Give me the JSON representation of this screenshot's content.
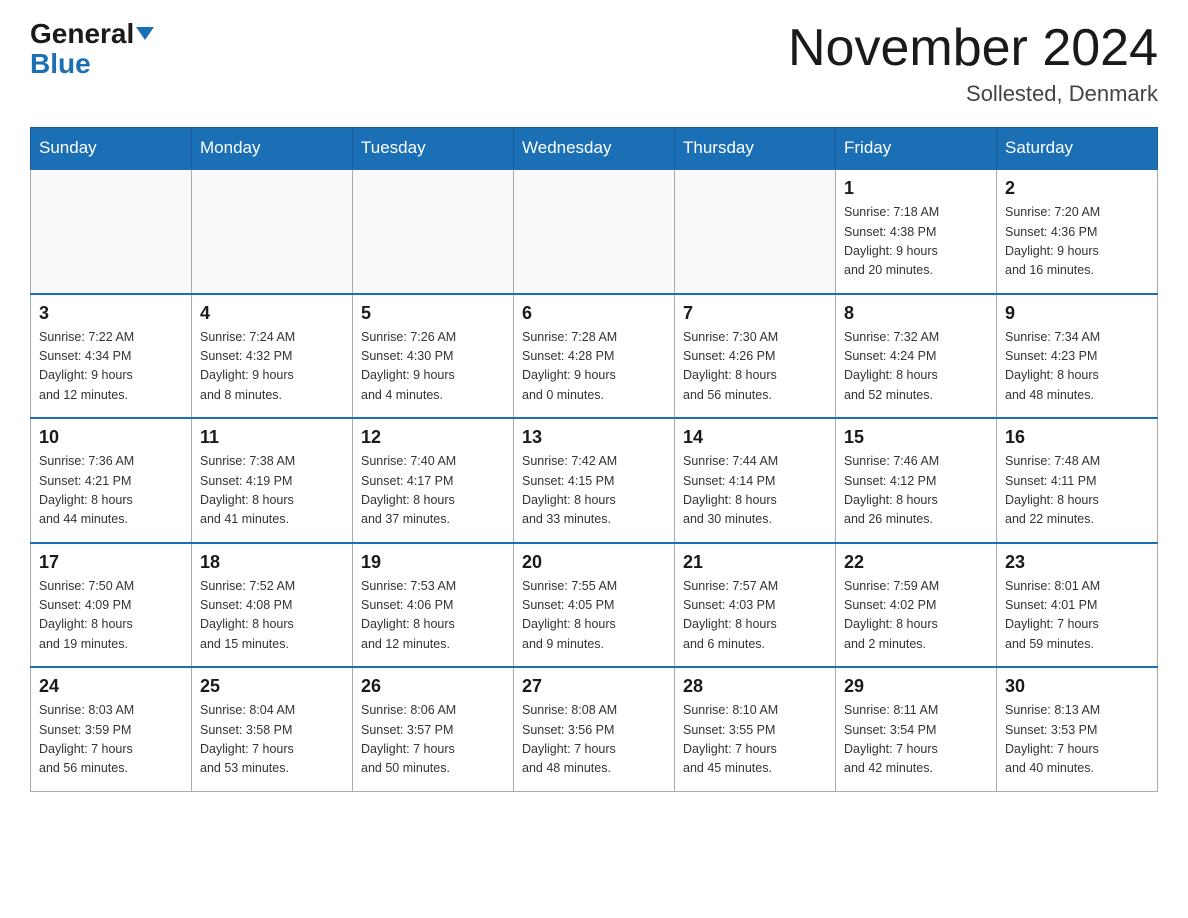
{
  "header": {
    "logo_general": "General",
    "logo_blue": "Blue",
    "month_title": "November 2024",
    "location": "Sollested, Denmark"
  },
  "days_of_week": [
    "Sunday",
    "Monday",
    "Tuesday",
    "Wednesday",
    "Thursday",
    "Friday",
    "Saturday"
  ],
  "weeks": [
    [
      {
        "day": "",
        "info": ""
      },
      {
        "day": "",
        "info": ""
      },
      {
        "day": "",
        "info": ""
      },
      {
        "day": "",
        "info": ""
      },
      {
        "day": "",
        "info": ""
      },
      {
        "day": "1",
        "info": "Sunrise: 7:18 AM\nSunset: 4:38 PM\nDaylight: 9 hours\nand 20 minutes."
      },
      {
        "day": "2",
        "info": "Sunrise: 7:20 AM\nSunset: 4:36 PM\nDaylight: 9 hours\nand 16 minutes."
      }
    ],
    [
      {
        "day": "3",
        "info": "Sunrise: 7:22 AM\nSunset: 4:34 PM\nDaylight: 9 hours\nand 12 minutes."
      },
      {
        "day": "4",
        "info": "Sunrise: 7:24 AM\nSunset: 4:32 PM\nDaylight: 9 hours\nand 8 minutes."
      },
      {
        "day": "5",
        "info": "Sunrise: 7:26 AM\nSunset: 4:30 PM\nDaylight: 9 hours\nand 4 minutes."
      },
      {
        "day": "6",
        "info": "Sunrise: 7:28 AM\nSunset: 4:28 PM\nDaylight: 9 hours\nand 0 minutes."
      },
      {
        "day": "7",
        "info": "Sunrise: 7:30 AM\nSunset: 4:26 PM\nDaylight: 8 hours\nand 56 minutes."
      },
      {
        "day": "8",
        "info": "Sunrise: 7:32 AM\nSunset: 4:24 PM\nDaylight: 8 hours\nand 52 minutes."
      },
      {
        "day": "9",
        "info": "Sunrise: 7:34 AM\nSunset: 4:23 PM\nDaylight: 8 hours\nand 48 minutes."
      }
    ],
    [
      {
        "day": "10",
        "info": "Sunrise: 7:36 AM\nSunset: 4:21 PM\nDaylight: 8 hours\nand 44 minutes."
      },
      {
        "day": "11",
        "info": "Sunrise: 7:38 AM\nSunset: 4:19 PM\nDaylight: 8 hours\nand 41 minutes."
      },
      {
        "day": "12",
        "info": "Sunrise: 7:40 AM\nSunset: 4:17 PM\nDaylight: 8 hours\nand 37 minutes."
      },
      {
        "day": "13",
        "info": "Sunrise: 7:42 AM\nSunset: 4:15 PM\nDaylight: 8 hours\nand 33 minutes."
      },
      {
        "day": "14",
        "info": "Sunrise: 7:44 AM\nSunset: 4:14 PM\nDaylight: 8 hours\nand 30 minutes."
      },
      {
        "day": "15",
        "info": "Sunrise: 7:46 AM\nSunset: 4:12 PM\nDaylight: 8 hours\nand 26 minutes."
      },
      {
        "day": "16",
        "info": "Sunrise: 7:48 AM\nSunset: 4:11 PM\nDaylight: 8 hours\nand 22 minutes."
      }
    ],
    [
      {
        "day": "17",
        "info": "Sunrise: 7:50 AM\nSunset: 4:09 PM\nDaylight: 8 hours\nand 19 minutes."
      },
      {
        "day": "18",
        "info": "Sunrise: 7:52 AM\nSunset: 4:08 PM\nDaylight: 8 hours\nand 15 minutes."
      },
      {
        "day": "19",
        "info": "Sunrise: 7:53 AM\nSunset: 4:06 PM\nDaylight: 8 hours\nand 12 minutes."
      },
      {
        "day": "20",
        "info": "Sunrise: 7:55 AM\nSunset: 4:05 PM\nDaylight: 8 hours\nand 9 minutes."
      },
      {
        "day": "21",
        "info": "Sunrise: 7:57 AM\nSunset: 4:03 PM\nDaylight: 8 hours\nand 6 minutes."
      },
      {
        "day": "22",
        "info": "Sunrise: 7:59 AM\nSunset: 4:02 PM\nDaylight: 8 hours\nand 2 minutes."
      },
      {
        "day": "23",
        "info": "Sunrise: 8:01 AM\nSunset: 4:01 PM\nDaylight: 7 hours\nand 59 minutes."
      }
    ],
    [
      {
        "day": "24",
        "info": "Sunrise: 8:03 AM\nSunset: 3:59 PM\nDaylight: 7 hours\nand 56 minutes."
      },
      {
        "day": "25",
        "info": "Sunrise: 8:04 AM\nSunset: 3:58 PM\nDaylight: 7 hours\nand 53 minutes."
      },
      {
        "day": "26",
        "info": "Sunrise: 8:06 AM\nSunset: 3:57 PM\nDaylight: 7 hours\nand 50 minutes."
      },
      {
        "day": "27",
        "info": "Sunrise: 8:08 AM\nSunset: 3:56 PM\nDaylight: 7 hours\nand 48 minutes."
      },
      {
        "day": "28",
        "info": "Sunrise: 8:10 AM\nSunset: 3:55 PM\nDaylight: 7 hours\nand 45 minutes."
      },
      {
        "day": "29",
        "info": "Sunrise: 8:11 AM\nSunset: 3:54 PM\nDaylight: 7 hours\nand 42 minutes."
      },
      {
        "day": "30",
        "info": "Sunrise: 8:13 AM\nSunset: 3:53 PM\nDaylight: 7 hours\nand 40 minutes."
      }
    ]
  ]
}
